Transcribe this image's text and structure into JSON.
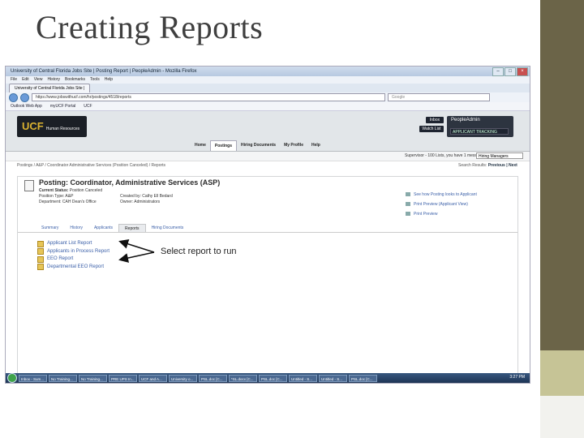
{
  "slide": {
    "title": "Creating Reports",
    "annotation": "Select report to run"
  },
  "browser": {
    "window_title": "University of Central Florida Jobs Site | Posting Report | PeopleAdmin - Mozilla Firefox",
    "menu": [
      "File",
      "Edit",
      "View",
      "History",
      "Bookmarks",
      "Tools",
      "Help"
    ],
    "tab_label": "University of Central Florida Jobs Site |",
    "url": "https://www.jobswithucf.com/hr/postings/4518/reports",
    "search_placeholder": "Google",
    "bookmarks": [
      "Outlook Web App",
      "myUCF Portal",
      "UCF"
    ]
  },
  "app": {
    "logo_text": "UCF",
    "logo_sub": "Human Resources",
    "brand": "PeopleAdmin",
    "module_select": "APPLICANT TRACKING",
    "inbox_btn": "Inbox",
    "watch_btn": "Watch List",
    "nav": [
      "Home",
      "Postings",
      "Hiring Documents",
      "My Profile",
      "Help"
    ],
    "status_text": "Supervisor - 100 Lists, you have 1 message",
    "status_select": "Hiring Managers",
    "breadcrumb": "Postings / A&P / Coordinator Administrative Services (Position Canceled) / Reports",
    "search_results_label": "Search Results:",
    "search_results_links": "Previous | Next",
    "posting": {
      "title": "Posting: Coordinator, Administrative Services (ASP)",
      "current_status_label": "Current Status:",
      "current_status": "Position Canceled",
      "position_type": "Position Type:  A&P",
      "department": "Department:  CAH Dean's Office",
      "created_by": "Created by:  Cathy Ell Bedard",
      "owner": "Owner:  Administrators"
    },
    "side_links": [
      "See how Posting looks to Applicant",
      "Print Preview (Applicant View)",
      "Print Preview"
    ],
    "subtabs": [
      "Summary",
      "History",
      "Applicants",
      "Reports",
      "Hiring Documents"
    ],
    "reports": [
      "Applicant List Report",
      "Applicants in Process Report",
      "EEO Report",
      "Departmental EEO Report"
    ]
  },
  "taskbar": {
    "buttons": [
      "Inbox - Sum...",
      "No Training...",
      "No Training...",
      "PRE UPS In...",
      "UCF and A...",
      "University o...",
      "PSL.doc [C...",
      "*SL.docx [C...",
      "PSL.doc [C...",
      "Untitled - S...",
      "Untitled - S...",
      "PSL.doc [C..."
    ],
    "clock": "3:27 PM"
  }
}
